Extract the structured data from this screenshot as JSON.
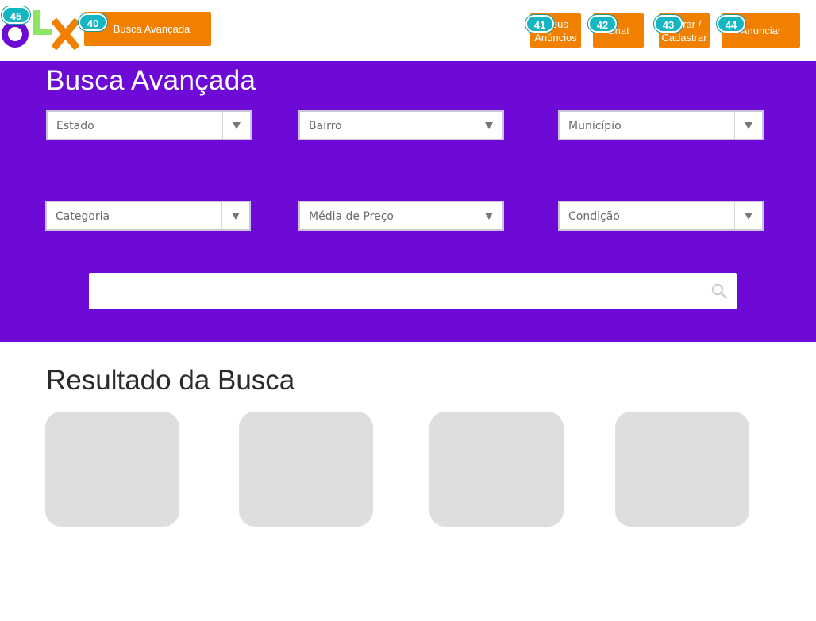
{
  "header": {
    "busca_avancada": "Busca Avançada",
    "meus_anuncios": [
      "Meus",
      "Anúncios"
    ],
    "chat": "Chat",
    "entrar": [
      "Entrar /",
      "Cadastrar"
    ],
    "anunciar": "Anunciar"
  },
  "badges": {
    "logo": "45",
    "busca_avancada": "40",
    "meus_anuncios": "41",
    "chat": "42",
    "entrar": "43",
    "anunciar": "44"
  },
  "search": {
    "title": "Busca Avançada",
    "filters": [
      "Estado",
      "Bairro",
      "Município",
      "Categoria",
      "Média de Preço",
      "Condição"
    ],
    "input_value": "",
    "input_placeholder": ""
  },
  "results": {
    "title": "Resultado da Busca",
    "card_count": 4
  },
  "colors": {
    "brand_purple": "#6e0ad6",
    "brand_orange": "#f28000",
    "brand_green": "#8ce563",
    "badge_teal": "#14b7c1",
    "card_gray": "#dedede"
  },
  "icons": [
    "logo-o-icon",
    "logo-l-icon",
    "logo-x-icon",
    "chevron-down-icon",
    "search-icon"
  ]
}
